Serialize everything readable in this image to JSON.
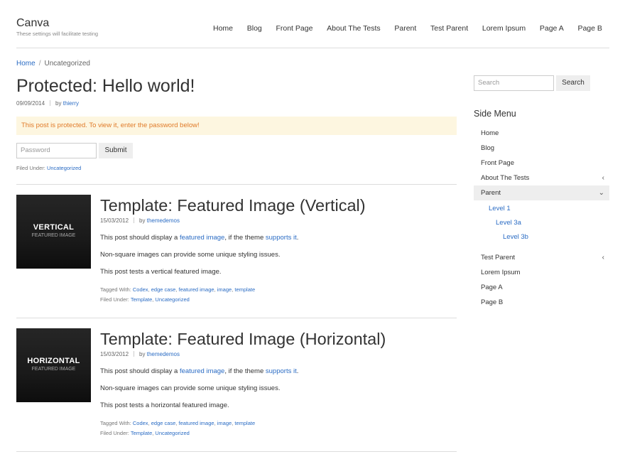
{
  "site": {
    "title": "Canva",
    "description": "These settings will facilitate testing"
  },
  "nav": [
    "Home",
    "Blog",
    "Front Page",
    "About The Tests",
    "Parent",
    "Test Parent",
    "Lorem Ipsum",
    "Page A",
    "Page B"
  ],
  "breadcrumb": {
    "home": "Home",
    "separator": "/",
    "current": "Uncategorized"
  },
  "protected_post": {
    "title": "Protected: Hello world!",
    "date": "09/09/2014",
    "by": "by",
    "author": "thierry",
    "notice": "This post is protected. To view it, enter the password below!",
    "password_placeholder": "Password",
    "submit_label": "Submit",
    "filed_label": "Filed Under:",
    "filed_category": "Uncategorized"
  },
  "posts": [
    {
      "thumb_big": "VERTICAL",
      "thumb_small": "FEATURED IMAGE",
      "title": "Template: Featured Image (Vertical)",
      "date": "15/03/2012",
      "by": "by",
      "author": "themedemos",
      "p1_before": "This post should display a ",
      "p1_link1": "featured image",
      "p1_middle": ", if the theme ",
      "p1_link2": "supports it",
      "p1_after": ".",
      "p2": "Non-square images can provide some unique styling issues.",
      "p3": "This post tests a vertical featured image.",
      "tagged_label": "Tagged With:",
      "tags": [
        "Codex",
        "edge case",
        "featured image",
        "image",
        "template"
      ],
      "filed_label": "Filed Under:",
      "categories": [
        "Template",
        "Uncategorized"
      ]
    },
    {
      "thumb_big": "HORIZONTAL",
      "thumb_small": "FEATURED IMAGE",
      "title": "Template: Featured Image (Horizontal)",
      "date": "15/03/2012",
      "by": "by",
      "author": "themedemos",
      "p1_before": "This post should display a ",
      "p1_link1": "featured image",
      "p1_middle": ", if the theme ",
      "p1_link2": "supports it",
      "p1_after": ".",
      "p2": "Non-square images can provide some unique styling issues.",
      "p3": "This post tests a horizontal featured image.",
      "tagged_label": "Tagged With:",
      "tags": [
        "Codex",
        "edge case",
        "featured image",
        "image",
        "template"
      ],
      "filed_label": "Filed Under:",
      "categories": [
        "Template",
        "Uncategorized"
      ]
    }
  ],
  "sidebar": {
    "search_placeholder": "Search",
    "search_button": "Search",
    "menu_title": "Side Menu",
    "menu": {
      "home": "Home",
      "blog": "Blog",
      "front_page": "Front Page",
      "about": "About The Tests",
      "parent": "Parent",
      "level1": "Level 1",
      "level3a": "Level 3a",
      "level3b": "Level 3b",
      "test_parent": "Test Parent",
      "lorem": "Lorem Ipsum",
      "page_a": "Page A",
      "page_b": "Page B"
    }
  },
  "colors": {
    "link": "#2b6cc4",
    "notice_bg": "#fdf6e0",
    "notice_text": "#e07a28",
    "active_menu_bg": "#eeeeee"
  }
}
